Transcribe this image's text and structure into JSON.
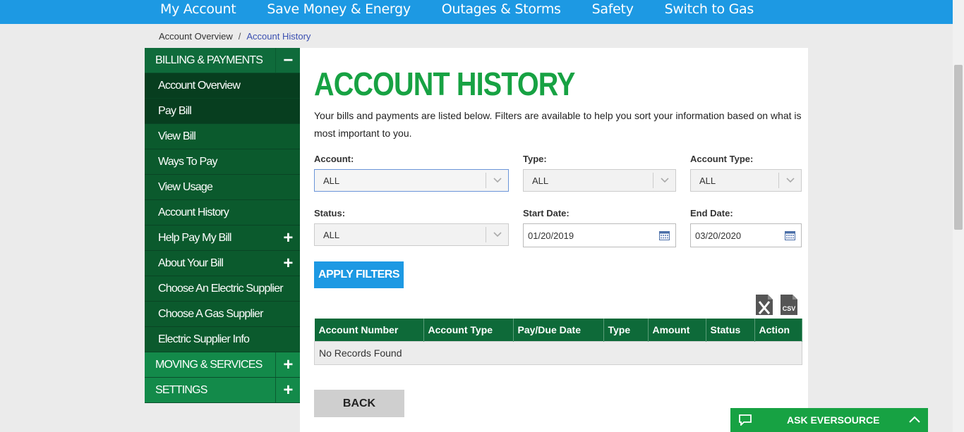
{
  "nav": {
    "items": [
      "My Account",
      "Save Money & Energy",
      "Outages & Storms",
      "Safety",
      "Switch to Gas"
    ]
  },
  "breadcrumb": {
    "parent": "Account Overview",
    "sep": "/",
    "current": "Account History"
  },
  "sidebar": {
    "billing_header": "BILLING & PAYMENTS",
    "billing_toggle": "−",
    "items": [
      {
        "label": "Account Overview"
      },
      {
        "label": "Pay Bill"
      },
      {
        "label": "View Bill"
      },
      {
        "label": "Ways To Pay"
      },
      {
        "label": "View Usage"
      },
      {
        "label": "Account History"
      },
      {
        "label": "Help Pay My Bill",
        "toggle": "+"
      },
      {
        "label": "About Your Bill",
        "toggle": "+"
      },
      {
        "label": "Choose An Electric Supplier"
      },
      {
        "label": "Choose A Gas Supplier"
      },
      {
        "label": "Electric Supplier Info"
      }
    ],
    "moving_header": "MOVING & SERVICES",
    "settings_header": "SETTINGS",
    "plus": "+"
  },
  "main": {
    "title": "ACCOUNT HISTORY",
    "intro": "Your bills and payments are listed below. Filters are available to help you sort your information based on what is most important to you.",
    "filters": {
      "account_label": "Account:",
      "account_value": "ALL",
      "type_label": "Type:",
      "type_value": "ALL",
      "account_type_label": "Account Type:",
      "account_type_value": "ALL",
      "status_label": "Status:",
      "status_value": "ALL",
      "start_label": "Start Date:",
      "start_value": "01/20/2019",
      "end_label": "End Date:",
      "end_value": "03/20/2020"
    },
    "apply_label": "APPLY FILTERS",
    "export": {
      "excel_icon": "excel-export-icon",
      "csv_icon": "csv-export-icon",
      "csv_text": "CSV"
    },
    "table": {
      "columns": [
        "Account Number",
        "Account Type",
        "Pay/Due Date",
        "Type",
        "Amount",
        "Status",
        "Action"
      ],
      "empty_text": "No Records Found"
    },
    "back_label": "BACK"
  },
  "chat": {
    "label": "ASK EVERSOURCE"
  },
  "colors": {
    "brand_green": "#17a243",
    "nav_blue": "#1d99e3",
    "sidebar_green": "#0b5a2d"
  }
}
